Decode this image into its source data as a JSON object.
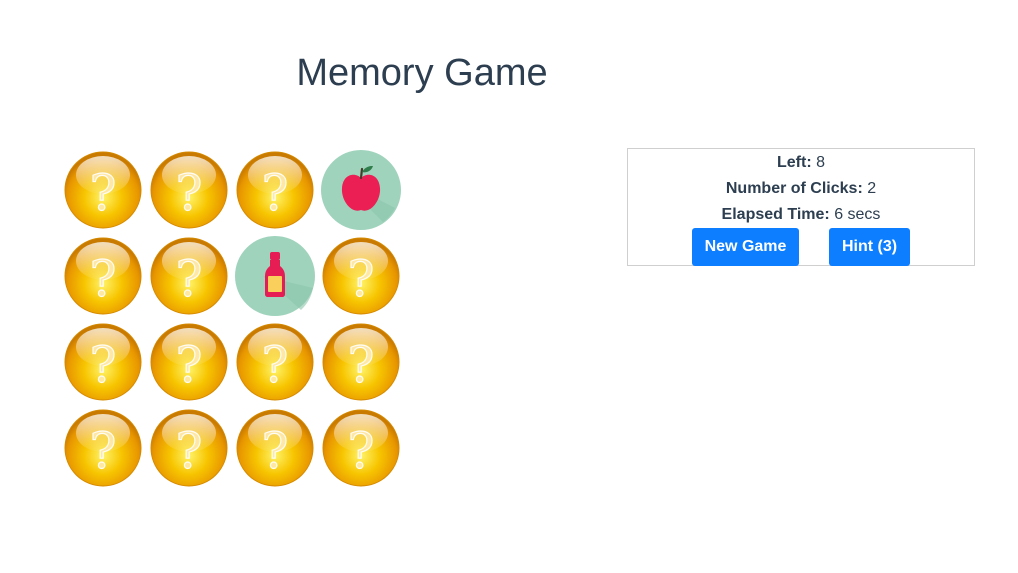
{
  "title": "Memory Game",
  "stats": {
    "left_label": "Left:",
    "left_value": "8",
    "clicks_label": "Number of Clicks:",
    "clicks_value": "2",
    "time_label": "Elapsed Time:",
    "time_value": "6 secs"
  },
  "buttons": {
    "new_game": "New Game",
    "hint": "Hint (3)"
  },
  "board": {
    "rows": 4,
    "cols": 4,
    "cards": [
      "hidden",
      "hidden",
      "hidden",
      "apple",
      "hidden",
      "hidden",
      "bottle",
      "hidden",
      "hidden",
      "hidden",
      "hidden",
      "hidden",
      "hidden",
      "hidden",
      "hidden",
      "hidden"
    ]
  },
  "colors": {
    "accent": "#0d7eff",
    "text": "#2c3e50",
    "card_back": "#f5b800",
    "revealed_bg": "#9fd3bc"
  }
}
